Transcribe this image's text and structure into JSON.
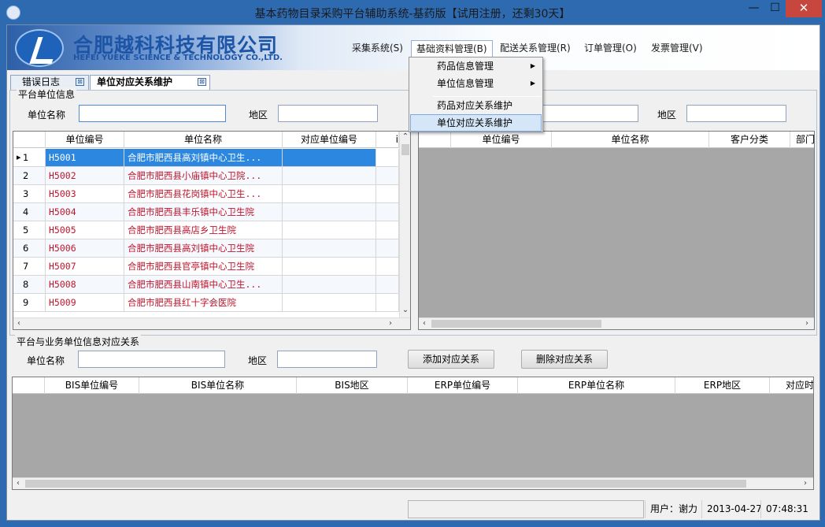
{
  "window": {
    "title": "基本药物目录采购平台辅助系统-基药版【试用注册，还剩30天】",
    "minimize": "—",
    "maximize": "☐",
    "close": "✕"
  },
  "banner": {
    "company_cn": "合肥越科科技有限公司",
    "company_en": "HEFEI YUEKE SCIENCE & TECHNOLOGY CO.,LTD."
  },
  "menu": [
    {
      "label": "采集系统(S)"
    },
    {
      "label": "基础资料管理(B)"
    },
    {
      "label": "配送关系管理(R)"
    },
    {
      "label": "订单管理(O)"
    },
    {
      "label": "发票管理(V)"
    }
  ],
  "dropdown": {
    "items": [
      {
        "label": "药品信息管理",
        "submenu": "▶"
      },
      {
        "label": "单位信息管理",
        "submenu": "▶"
      },
      {
        "label": "药品对应关系维护"
      },
      {
        "label": "单位对应关系维护"
      }
    ]
  },
  "tabs": [
    {
      "label": "错误日志",
      "close": "⊠"
    },
    {
      "label": "单位对应关系维护",
      "close": "⊠"
    }
  ],
  "platform": {
    "group_label": "平台单位信息",
    "name_label": "单位名称",
    "region_label": "地区",
    "name_value": "",
    "region_value": "",
    "right_region_label": "地区",
    "columns": [
      "单位编号",
      "单位名称",
      "对应单位编号",
      "i"
    ],
    "rows": [
      {
        "rn": "1",
        "code": "H5001",
        "name": "合肥市肥西县高刘镇中心卫生...",
        "selected": true
      },
      {
        "rn": "2",
        "code": "H5002",
        "name": "合肥市肥西县小庙镇中心卫院..."
      },
      {
        "rn": "3",
        "code": "H5003",
        "name": "合肥市肥西县花岗镇中心卫生..."
      },
      {
        "rn": "4",
        "code": "H5004",
        "name": "合肥市肥西县丰乐镇中心卫生院"
      },
      {
        "rn": "5",
        "code": "H5005",
        "name": "合肥市肥西县高店乡卫生院"
      },
      {
        "rn": "6",
        "code": "H5006",
        "name": "合肥市肥西县高刘镇中心卫生院"
      },
      {
        "rn": "7",
        "code": "H5007",
        "name": "合肥市肥西县官亭镇中心卫生院"
      },
      {
        "rn": "8",
        "code": "H5008",
        "name": "合肥市肥西县山南镇中心卫生..."
      },
      {
        "rn": "9",
        "code": "H5009",
        "name": "合肥市肥西县红十字会医院"
      }
    ]
  },
  "business": {
    "columns": [
      "单位编号",
      "单位名称",
      "客户分类",
      "部门"
    ]
  },
  "mapping": {
    "group_label": "平台与业务单位信息对应关系",
    "name_label": "单位名称",
    "region_label": "地区",
    "add_button": "添加对应关系",
    "delete_button": "删除对应关系",
    "columns": [
      "BIS单位编号",
      "BIS单位名称",
      "BIS地区",
      "ERP单位编号",
      "ERP单位名称",
      "ERP地区",
      "对应时"
    ]
  },
  "status": {
    "user": "用户：谢力",
    "date": "2013-04-27",
    "time": "07:48:31"
  }
}
